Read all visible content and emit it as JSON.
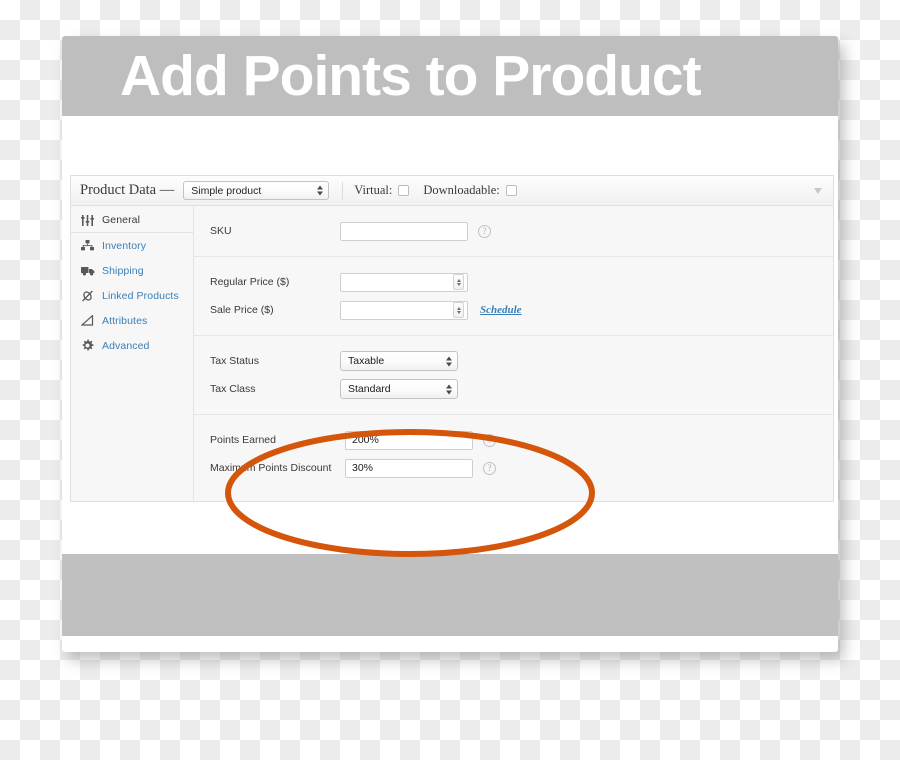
{
  "page": {
    "title": "Add Points to Product",
    "banner_color": "#bebebe",
    "accent_annotation_color": "#d4560b"
  },
  "panel": {
    "header": {
      "title": "Product Data —",
      "product_type": "Simple product",
      "virtual_label": "Virtual:",
      "virtual_checked": false,
      "downloadable_label": "Downloadable:",
      "downloadable_checked": false,
      "collapse_icon": "chevron-down-icon"
    },
    "tabs": [
      {
        "label": "General",
        "icon": "sliders-icon",
        "active": true
      },
      {
        "label": "Inventory",
        "icon": "hierarchy-icon",
        "active": false
      },
      {
        "label": "Shipping",
        "icon": "truck-icon",
        "active": false
      },
      {
        "label": "Linked Products",
        "icon": "link-icon",
        "active": false
      },
      {
        "label": "Attributes",
        "icon": "triangle-ruler-icon",
        "active": false
      },
      {
        "label": "Advanced",
        "icon": "gear-icon",
        "active": false
      }
    ],
    "fields": {
      "sku": {
        "label": "SKU",
        "value": "",
        "help": "?"
      },
      "regular_price": {
        "label": "Regular Price ($)",
        "value": ""
      },
      "sale_price": {
        "label": "Sale Price ($)",
        "value": "",
        "schedule_link": "Schedule"
      },
      "tax_status": {
        "label": "Tax Status",
        "value": "Taxable"
      },
      "tax_class": {
        "label": "Tax Class",
        "value": "Standard"
      },
      "points_earned": {
        "label": "Points Earned",
        "value": "200%",
        "help": "?"
      },
      "max_points_discount": {
        "label": "Maximum Points Discount",
        "value": "30%",
        "help": "?"
      }
    }
  },
  "link_color": "#3a7fb8"
}
